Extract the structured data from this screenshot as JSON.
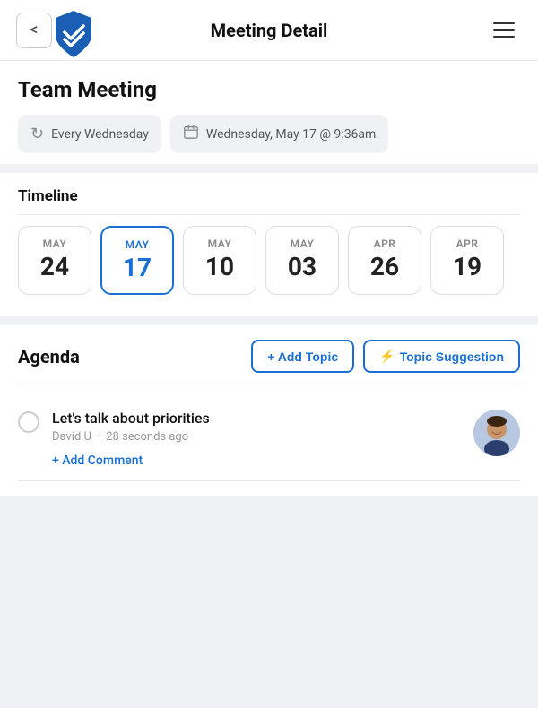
{
  "header": {
    "back_label": "<",
    "title": "Meeting Detail",
    "menu_icon": "menu-icon"
  },
  "logo": {
    "icon": "shield-chevron-icon"
  },
  "meeting": {
    "title": "Team Meeting",
    "recurrence": "Every Wednesday",
    "recurrence_icon": "refresh-icon",
    "date_time": "Wednesday, May 17 @ 9:36am",
    "calendar_icon": "calendar-icon"
  },
  "timeline": {
    "label": "Timeline",
    "dates": [
      {
        "month": "MAY",
        "day": "24",
        "active": false
      },
      {
        "month": "MAY",
        "day": "17",
        "active": true
      },
      {
        "month": "MAY",
        "day": "10",
        "active": false
      },
      {
        "month": "MAY",
        "day": "03",
        "active": false
      },
      {
        "month": "APR",
        "day": "26",
        "active": false
      },
      {
        "month": "APR",
        "day": "19",
        "active": false
      }
    ]
  },
  "agenda": {
    "label": "Agenda",
    "add_topic_button": "+ Add Topic",
    "topic_suggestion_button": "Topic Suggestion",
    "items": [
      {
        "title": "Let's talk about priorities",
        "author": "David U",
        "time_ago": "28 seconds ago",
        "add_comment_label": "+ Add Comment"
      }
    ]
  }
}
